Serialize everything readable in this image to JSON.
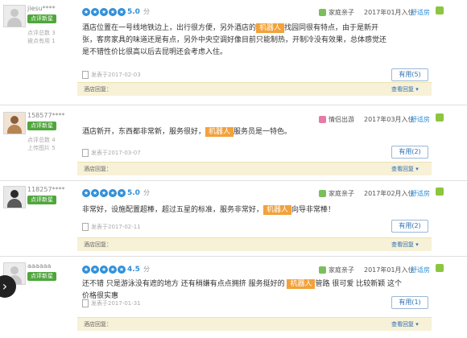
{
  "reviews": [
    {
      "username": "jiesu****",
      "badge": "点评新星",
      "stat1": "点评总数 3",
      "stat2": "被点有用 1",
      "score": "5.0",
      "score_unit": "分",
      "trip_type": "家庭亲子",
      "stay_date": "2017年01月入住",
      "recommend": "舒适房",
      "text_before": "酒店位置在一号线地铁边上，出行很方便，另外酒店的",
      "highlight": "机器人",
      "text_after": "找园同很有特点，由于是新开张，客房家具的味道还是有点，另外中央空调好像目前只能制热，开制冷没有效果，总体感觉还是不错性价比很高以后去昆明还会考虑入住。",
      "published": "发表于2017-02-03",
      "useful": "有用(5)",
      "reply_label": "酒店回复：",
      "reply_link": "查看回复 ▾"
    },
    {
      "username": "158577****",
      "badge": "点评新星",
      "stat1": "点评总数 4",
      "stat2": "上传图片 5",
      "score": "",
      "score_unit": "",
      "trip_type": "情侣出游",
      "stay_date": "2017年03月入住",
      "recommend": "舒适房",
      "text_before": "酒店新开，东西都非常新，服务很好，",
      "highlight": "机器人",
      "text_after": "服务员是一特色。",
      "published": "发表于2017-03-07",
      "useful": "有用(2)",
      "reply_label": "酒店回复：",
      "reply_link": "查看回复 ▾"
    },
    {
      "username": "118257****",
      "badge": "点评新星",
      "stat1": "",
      "stat2": "",
      "score": "5.0",
      "score_unit": "分",
      "trip_type": "家庭亲子",
      "stay_date": "2017年02月入住",
      "recommend": "舒适房",
      "text_before": "非常好，设施配置超棒，超过五星的标准，服务非常好，",
      "highlight": "机器人",
      "text_after": "向导非常棒！",
      "published": "发表于2017-02-11",
      "useful": "有用(2)",
      "reply_label": "酒店回复：",
      "reply_link": "查看回复 ▾"
    },
    {
      "username": "aaaaaa",
      "badge": "点评新星",
      "stat1": "",
      "stat2": "",
      "score": "4.5",
      "score_unit": "分",
      "trip_type": "家庭亲子",
      "stay_date": "2017年01月入住",
      "recommend": "舒适房",
      "text_before": "还不错 只是游泳没有遮的地方 还有稍嫌有点点拥挤 服务挺好的 ",
      "highlight": "机器人",
      "text_after": "管路 很可爱 比较新颖 这个价格很实惠",
      "published": "发表于2017-01-31",
      "useful": "有用(1)",
      "reply_label": "酒店回复：",
      "reply_link": "查看回复 ▾"
    }
  ],
  "nav": {
    "side_arrow": "›"
  },
  "colors": {
    "highlight": "#f3a13a",
    "score": "#2f8fd9",
    "badge": "#4fa63c",
    "reply_bg": "#f7f1d7"
  }
}
